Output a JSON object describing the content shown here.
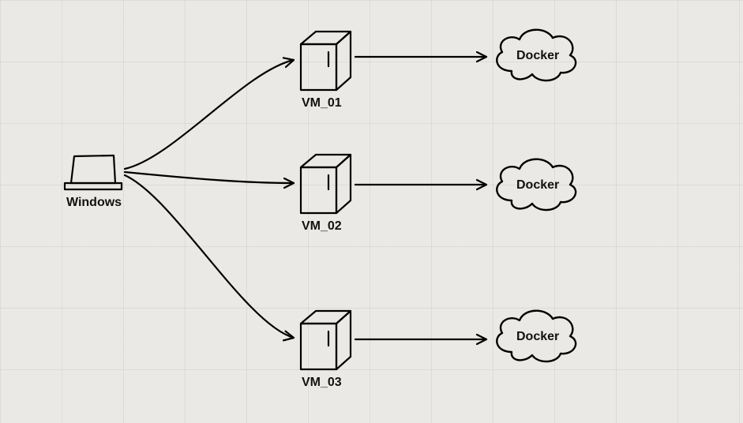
{
  "source": {
    "label": "Windows"
  },
  "vms": [
    {
      "label": "VM_01"
    },
    {
      "label": "VM_02"
    },
    {
      "label": "VM_03"
    }
  ],
  "clouds": [
    {
      "label": "Docker"
    },
    {
      "label": "Docker"
    },
    {
      "label": "Docker"
    }
  ]
}
